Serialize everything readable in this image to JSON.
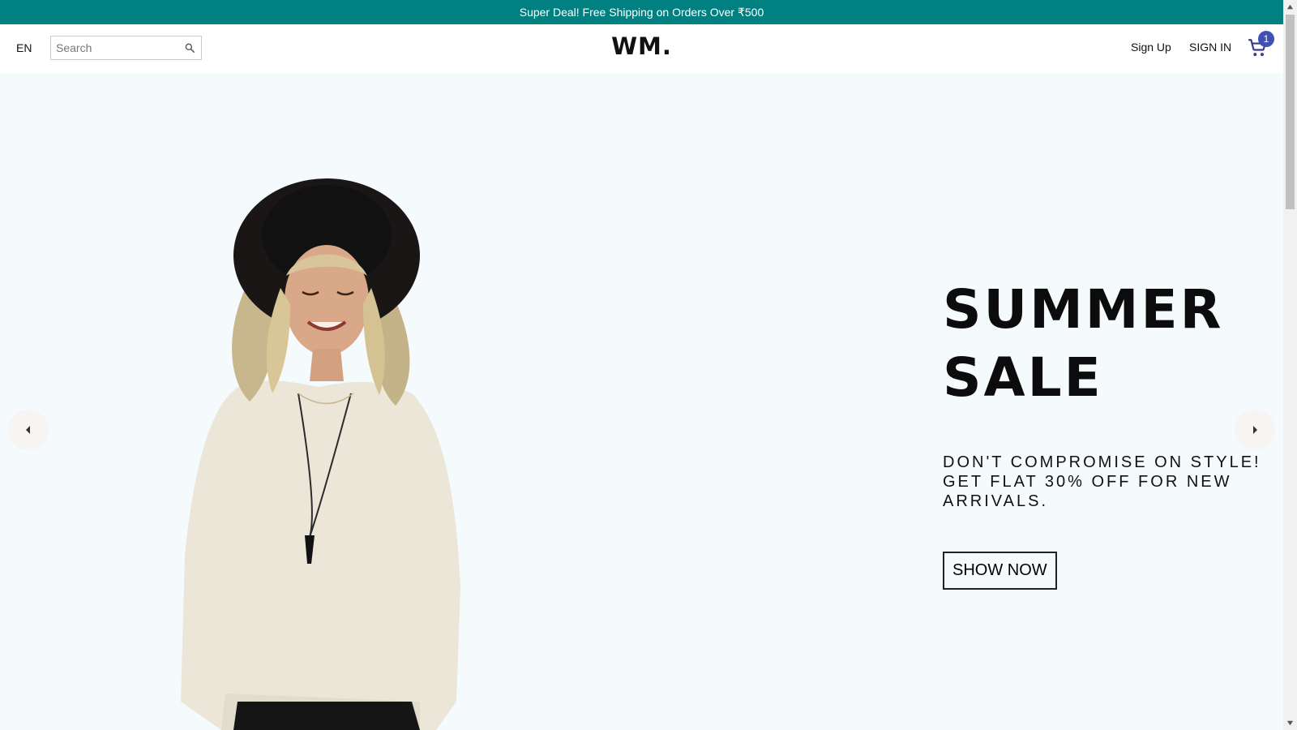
{
  "announcement": {
    "text": "Super Deal! Free Shipping on Orders Over ₹500"
  },
  "header": {
    "language": "EN",
    "search": {
      "placeholder": "Search",
      "value": ""
    },
    "logo": "WM.",
    "sign_up": "Sign Up",
    "sign_in": "SIGN IN",
    "cart_count": "1"
  },
  "hero": {
    "title_line1": "SUMMER",
    "title_line2": "SALE",
    "description": "DON'T COMPROMISE ON STYLE! GET FLAT 30% OFF FOR NEW ARRIVALS.",
    "button_label": "SHOW NOW"
  },
  "colors": {
    "announcement_bg": "#008080",
    "hero_bg": "#f5fafd",
    "cart_badge": "#3f51b5"
  },
  "icons": {
    "search": "search-icon",
    "cart": "shopping-cart-icon",
    "prev": "arrow-left-icon",
    "next": "arrow-right-icon"
  }
}
